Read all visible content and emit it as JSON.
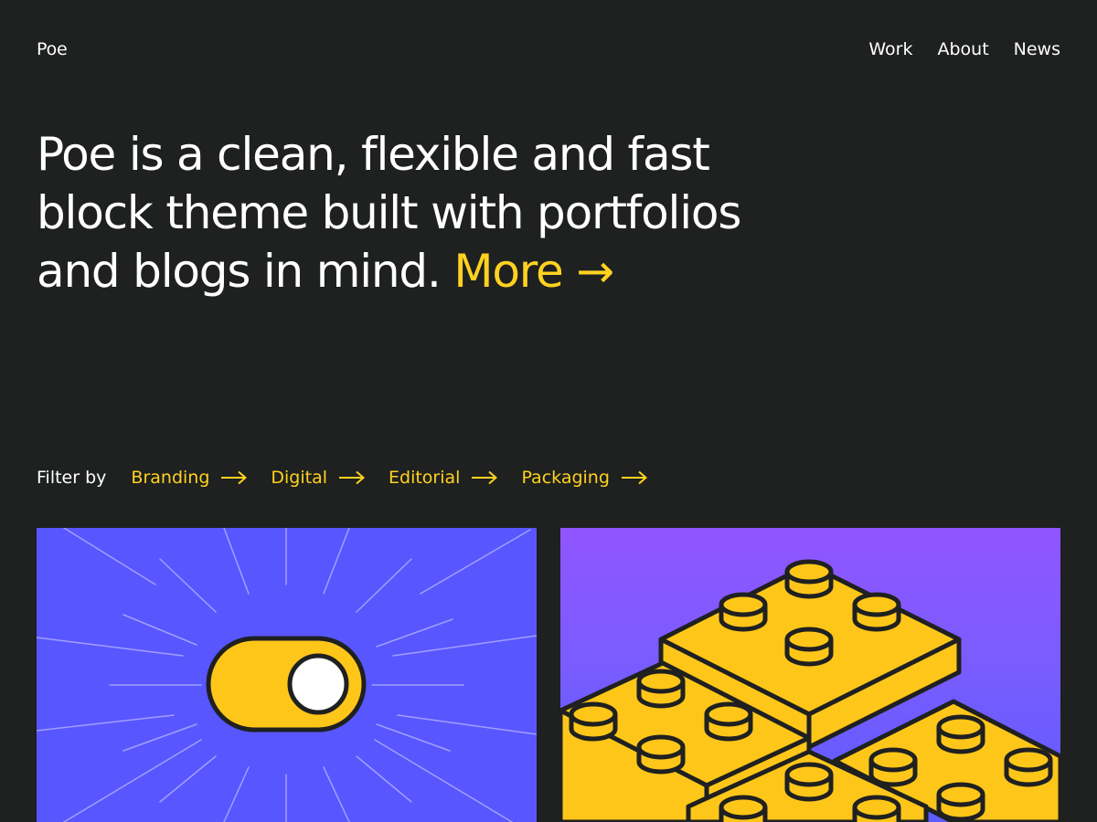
{
  "site": {
    "title": "Poe"
  },
  "nav": {
    "items": [
      {
        "label": "Work"
      },
      {
        "label": "About"
      },
      {
        "label": "News"
      }
    ]
  },
  "hero": {
    "text": "Poe is a clean, flexible and fast block theme built with portfolios and blogs in mind.",
    "more_label": "More →"
  },
  "filter": {
    "label": "Filter by",
    "items": [
      {
        "label": "Branding"
      },
      {
        "label": "Digital"
      },
      {
        "label": "Editorial"
      },
      {
        "label": "Packaging"
      }
    ]
  },
  "colors": {
    "background": "#1f2020",
    "accent": "#ffd21f",
    "card_blue": "#5856ff",
    "card_purple": "#9155ff"
  },
  "projects": [
    {
      "icon": "toggle-switch-icon"
    },
    {
      "icon": "lego-bricks-icon"
    }
  ]
}
